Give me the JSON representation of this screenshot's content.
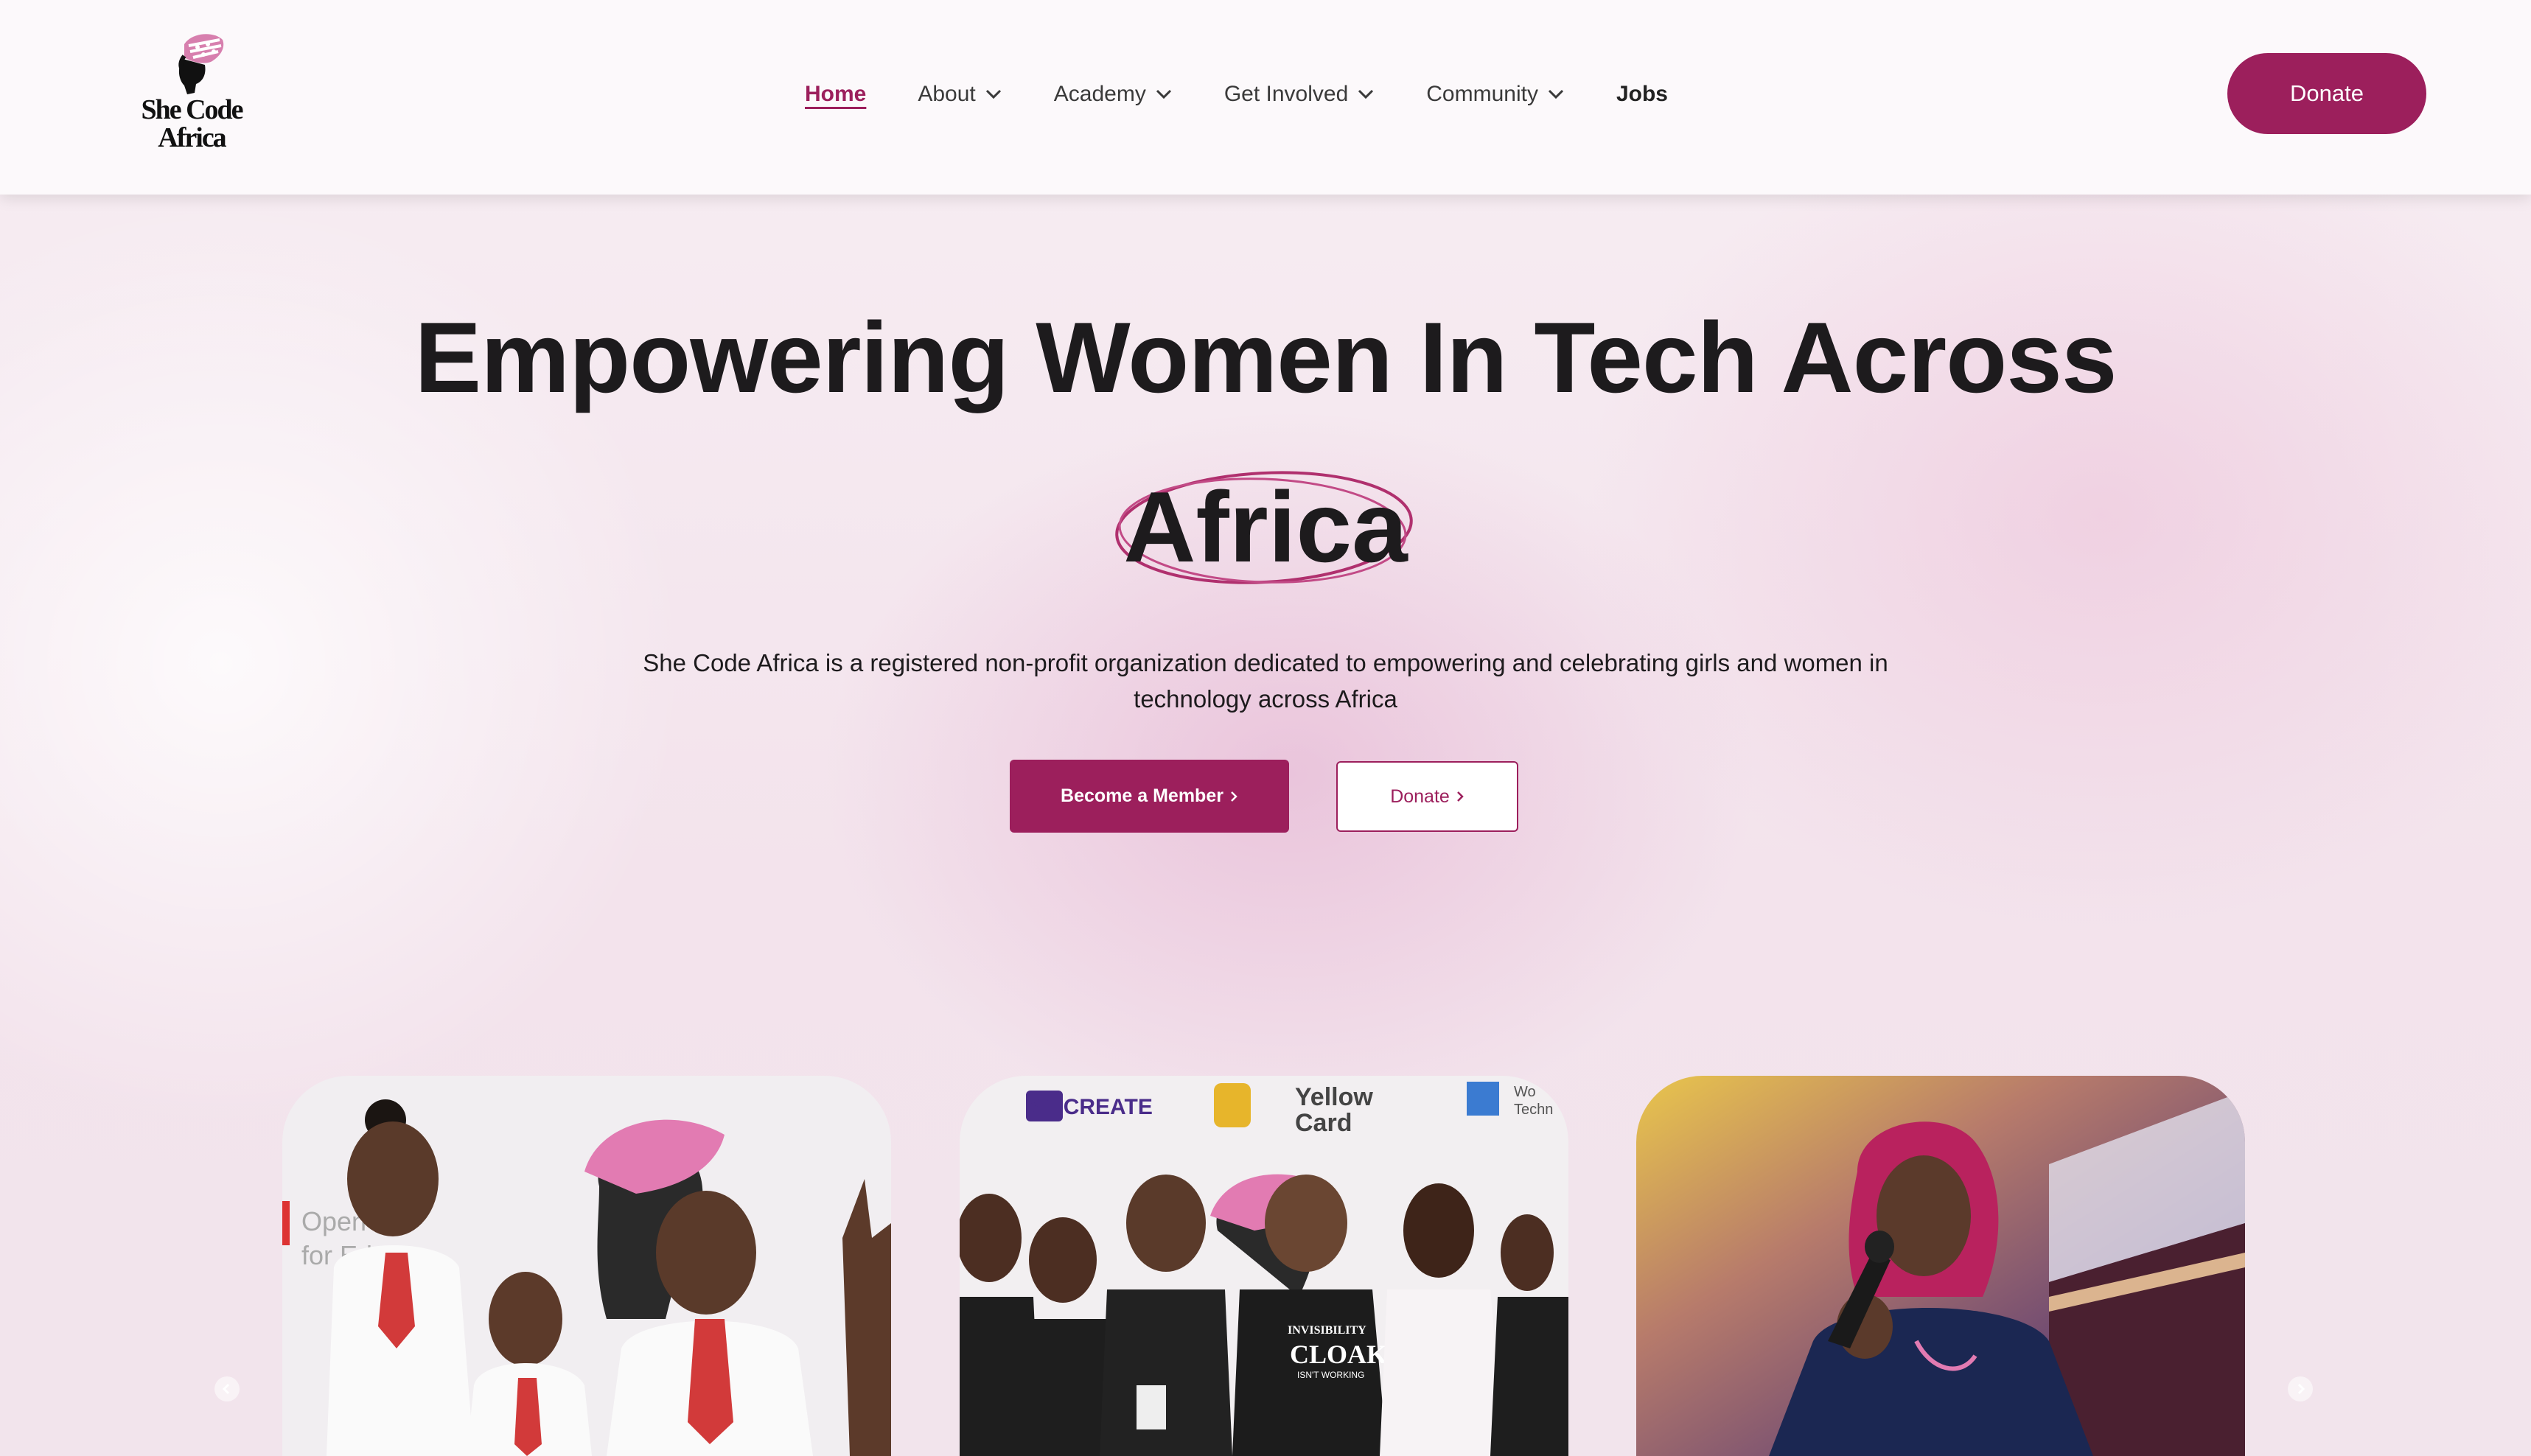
{
  "header": {
    "logo_text_line1": "She Code",
    "logo_text_line2": "Africa",
    "nav": [
      {
        "label": "Home",
        "active": true,
        "dropdown": false
      },
      {
        "label": "About",
        "active": false,
        "dropdown": true
      },
      {
        "label": "Academy",
        "active": false,
        "dropdown": true
      },
      {
        "label": "Get Involved",
        "active": false,
        "dropdown": true
      },
      {
        "label": "Community",
        "active": false,
        "dropdown": true
      },
      {
        "label": "Jobs",
        "active": false,
        "dropdown": false
      }
    ],
    "donate_label": "Donate"
  },
  "hero": {
    "title_line1": "Empowering Women In Tech Across",
    "title_line2": "Africa",
    "description_line1": "She Code Africa is a registered non-profit organization dedicated to empowering and celebrating girls and women in",
    "description_line2": "technology across Africa",
    "primary_button": "Become a Member",
    "secondary_button": "Donate"
  },
  "carousel": {
    "cards": [
      {
        "sign_line1": "Open",
        "sign_line2": "for Ed"
      },
      {
        "sponsor1": "WiiCREATE",
        "sponsor2_line1": "Yellow",
        "sponsor2_line2": "Card",
        "sponsor3": "Wo",
        "sponsor3b": "Techn",
        "shirt_line1": "INVISIBILITY",
        "shirt_line2": "CLOAK",
        "shirt_line3": "ISN'T WORKING"
      },
      {}
    ],
    "prev_icon": "chevron-left-icon",
    "next_icon": "chevron-right-icon"
  },
  "colors": {
    "brand": "#9c1f5c",
    "text": "#1d1b1d",
    "background": "#f6ecf2"
  }
}
